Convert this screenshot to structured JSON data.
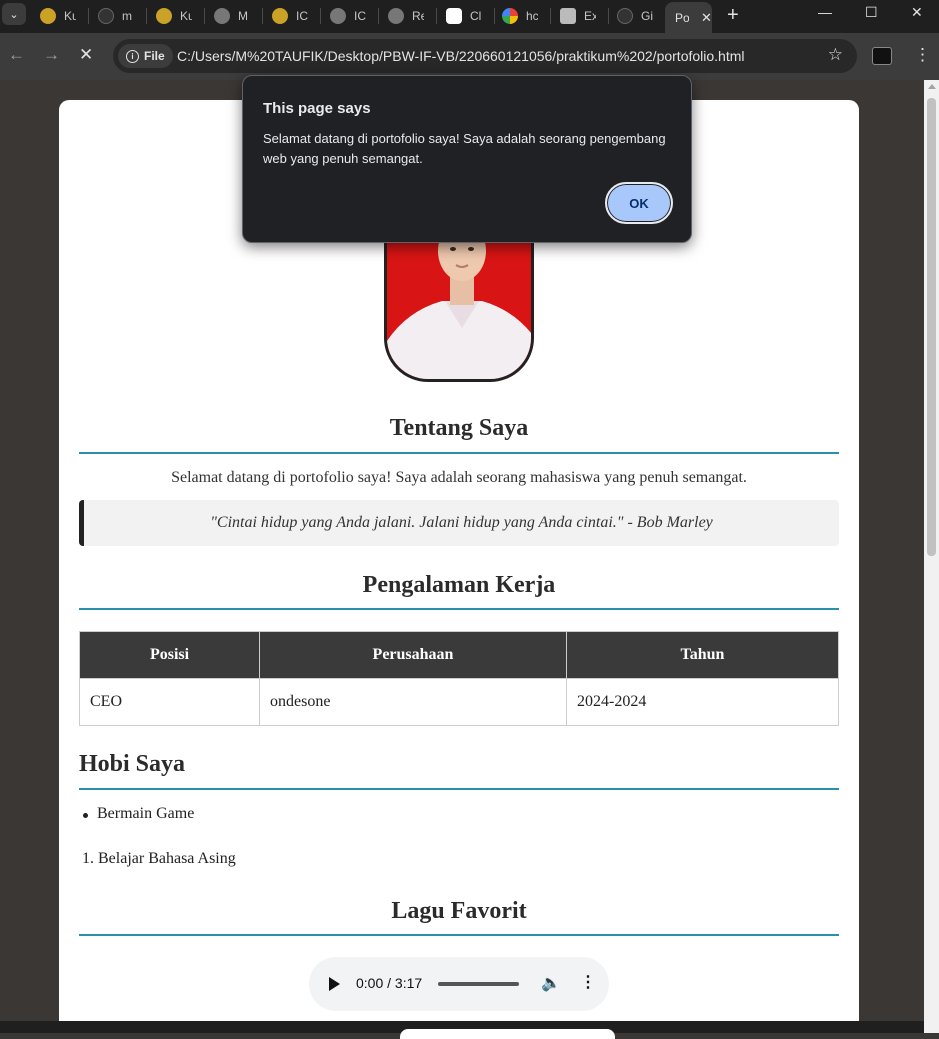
{
  "browser": {
    "tabs": [
      {
        "label": "Ku",
        "favicon": "emblem-icon"
      },
      {
        "label": "m",
        "favicon": "github-icon"
      },
      {
        "label": "Ku",
        "favicon": "emblem-icon"
      },
      {
        "label": "M",
        "favicon": "globe-icon"
      },
      {
        "label": "IC",
        "favicon": "emblem-icon"
      },
      {
        "label": "IC",
        "favicon": "globe-icon"
      },
      {
        "label": "Re",
        "favicon": "globe-icon"
      },
      {
        "label": "Cl",
        "favicon": "openai-icon"
      },
      {
        "label": "hc",
        "favicon": "google-icon"
      },
      {
        "label": "Ex",
        "favicon": "puzzle-icon"
      },
      {
        "label": "Gi",
        "favicon": "github-icon"
      }
    ],
    "active_tab": {
      "label": "Po",
      "close": "✕"
    },
    "new_tab": "+",
    "address": {
      "chip": "File",
      "url": "C:/Users/M%20TAUFIK/Desktop/PBW-IF-VB/220660121056/praktikum%202/portofolio.html"
    }
  },
  "dialog": {
    "title": "This page says",
    "message": "Selamat datang di portofolio saya! Saya adalah seorang pengembang web yang penuh semangat.",
    "ok_label": "OK"
  },
  "page": {
    "about": {
      "heading": "Tentang Saya",
      "intro": "Selamat datang di portofolio saya! Saya adalah seorang mahasiswa yang penuh semangat.",
      "quote": "\"Cintai hidup yang Anda jalani. Jalani hidup yang Anda cintai.\" - Bob Marley"
    },
    "experience": {
      "heading": "Pengalaman Kerja",
      "columns": [
        "Posisi",
        "Perusahaan",
        "Tahun"
      ],
      "rows": [
        [
          "CEO",
          "ondesone",
          "2024-2024"
        ]
      ]
    },
    "hobbies": {
      "heading": "Hobi Saya",
      "unordered": [
        "Bermain Game"
      ],
      "ordered": [
        "1. Belajar Bahasa Asing"
      ]
    },
    "music": {
      "heading": "Lagu Favorit",
      "time": "0:00 / 3:17"
    }
  },
  "colors": {
    "accent_rule": "#2a8fa8",
    "table_header": "#3a3a3a",
    "photo_background": "#d91414",
    "ok_button": "#a8c7fa"
  }
}
